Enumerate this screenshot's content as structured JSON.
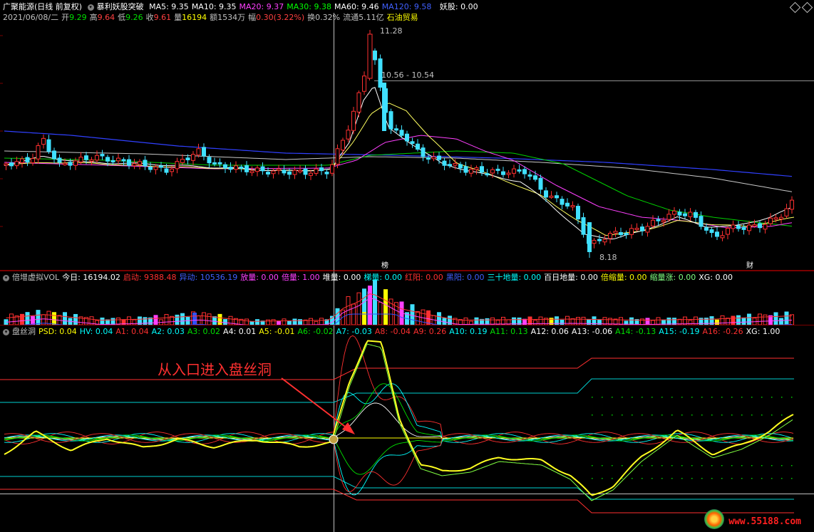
{
  "price_panel": {
    "stock_name": "广聚能源(日线 前复权)",
    "indicator": "暴利妖股突破",
    "ma_labels": [
      {
        "text": "MA5: 9.35",
        "color": "#ffffff"
      },
      {
        "text": "MA10: 9.35",
        "color": "#ffffff"
      },
      {
        "text": "MA20: 9.37",
        "color": "#ff40ff"
      },
      {
        "text": "MA30: 9.38",
        "color": "#00ff00"
      },
      {
        "text": "MA60: 9.46",
        "color": "#ffffff"
      },
      {
        "text": "MA120: 9.58",
        "color": "#4060ff"
      }
    ],
    "yao_gu": "妖股: 0.00",
    "date": "2021/06/08/二",
    "open_label": "开",
    "open_val": "9.29",
    "high_label": "高",
    "high_val": "9.64",
    "low_label": "低",
    "low_val": "9.26",
    "close_label": "收",
    "close_val": "9.61",
    "volume_label": "量",
    "volume_val": "16194",
    "amount": "额1534万",
    "change_label": "幅",
    "change_val": "0.30(3.22%)",
    "turnover": "换0.32%",
    "float_cap": "流通5.11亿",
    "sector": "石油贸易",
    "high_marker": "11.28",
    "crosshair_label": "10.56 - 10.54",
    "low_marker": "8.18",
    "tag_bang": "榜",
    "tag_cai": "财"
  },
  "volume_panel": {
    "items": [
      {
        "text": "倍增虚拟VOL",
        "color": "#c0c0c0"
      },
      {
        "text": "今日: 16194.02",
        "color": "#ffffff"
      },
      {
        "text": "启动: 9388.48",
        "color": "#ff3030"
      },
      {
        "text": "异动: 10536.19",
        "color": "#4060ff"
      },
      {
        "text": "放量: 0.00",
        "color": "#ff40ff"
      },
      {
        "text": "倍量: 1.00",
        "color": "#ff40ff"
      },
      {
        "text": "堆量: 0.00",
        "color": "#ffffff"
      },
      {
        "text": "梯量: 0.00",
        "color": "#00ffff"
      },
      {
        "text": "红阳: 0.00",
        "color": "#ff3030"
      },
      {
        "text": "黑阳: 0.00",
        "color": "#4060ff"
      },
      {
        "text": "三十地量: 0.00",
        "color": "#00ffff"
      },
      {
        "text": "百日地量: 0.00",
        "color": "#ffffff"
      },
      {
        "text": "倍缩量: 0.00",
        "color": "#ffff00"
      },
      {
        "text": "缩量涨: 0.00",
        "color": "#80ff80"
      },
      {
        "text": "XG: 0.00",
        "color": "#ffffff"
      }
    ]
  },
  "osc_panel": {
    "items": [
      {
        "text": "盘丝洞",
        "color": "#c0c0c0"
      },
      {
        "text": "PSD: 0.04",
        "color": "#ffff00"
      },
      {
        "text": "HV: 0.04",
        "color": "#00ffff"
      },
      {
        "text": "A1: 0.04",
        "color": "#ff3030"
      },
      {
        "text": "A2: 0.03",
        "color": "#00ffff"
      },
      {
        "text": "A3: 0.02",
        "color": "#00e000"
      },
      {
        "text": "A4: 0.01",
        "color": "#ffffff"
      },
      {
        "text": "A5: -0.01",
        "color": "#ffff00"
      },
      {
        "text": "A6: -0.02",
        "color": "#00e000"
      },
      {
        "text": "A7: -0.03",
        "color": "#00ffff"
      },
      {
        "text": "A8: -0.04",
        "color": "#ff3030"
      },
      {
        "text": "A9: 0.26",
        "color": "#ff3030"
      },
      {
        "text": "A10: 0.19",
        "color": "#00ffff"
      },
      {
        "text": "A11: 0.13",
        "color": "#00e000"
      },
      {
        "text": "A12: 0.06",
        "color": "#ffffff"
      },
      {
        "text": "A13: -0.06",
        "color": "#ffffff"
      },
      {
        "text": "A14: -0.13",
        "color": "#00e000"
      },
      {
        "text": "A15: -0.19",
        "color": "#00ffff"
      },
      {
        "text": "A16: -0.26",
        "color": "#ff3030"
      },
      {
        "text": "XG: 1.00",
        "color": "#ffffff"
      }
    ],
    "annotation": "从入口进入盘丝洞",
    "entry_marker": "$"
  },
  "watermark": "www.55188.com",
  "icons": {
    "panel_menu": "circle-chevron-icon",
    "nav_left": "diamond-left-icon",
    "nav_right": "diamond-right-icon"
  }
}
